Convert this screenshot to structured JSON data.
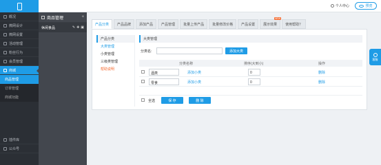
{
  "header": {
    "user": "个人中心",
    "preview": "预览"
  },
  "leftnav": {
    "items": [
      {
        "label": "概况"
      },
      {
        "label": "微网设计"
      },
      {
        "label": "微网设置"
      },
      {
        "label": "活动管理"
      },
      {
        "label": "粉丝行为"
      },
      {
        "label": "会员管理"
      },
      {
        "label": "商城"
      }
    ],
    "sub": [
      "商品管理",
      "订单管理",
      "商城功能"
    ],
    "bottom": [
      {
        "label": "插件库"
      },
      {
        "label": "公众号"
      }
    ]
  },
  "midnav": {
    "title": "商品管理",
    "plus": "+",
    "item": "休闲食品"
  },
  "tabs": [
    {
      "label": "产品分类"
    },
    {
      "label": "产品品牌"
    },
    {
      "label": "添加产品"
    },
    {
      "label": "产品管理"
    },
    {
      "label": "批量上传产品"
    },
    {
      "label": "批量修改价格"
    },
    {
      "label": "产品设置"
    },
    {
      "label": "展示效果",
      "badge": "NEW"
    },
    {
      "label": "使用帮助？"
    }
  ],
  "leftmenu": {
    "title": "产品分类",
    "items": [
      "大类管理",
      "小类管理",
      "三级类管理",
      "帮助说明"
    ]
  },
  "main": {
    "title": "大类管理",
    "category_label": "分类名:",
    "add_button": "添加大类",
    "table": {
      "headers": [
        "分类名称",
        "排序(大到小)",
        "操作"
      ],
      "rows": [
        {
          "name": "酒类",
          "add_sub": "添加小类",
          "order": "0",
          "action": "删除"
        },
        {
          "name": "零食",
          "add_sub": "添加小类",
          "order": "0",
          "action": "删除"
        }
      ]
    },
    "select_all": "全选",
    "save_button": "保 存",
    "delete_button": "删 除"
  },
  "help": "客服"
}
